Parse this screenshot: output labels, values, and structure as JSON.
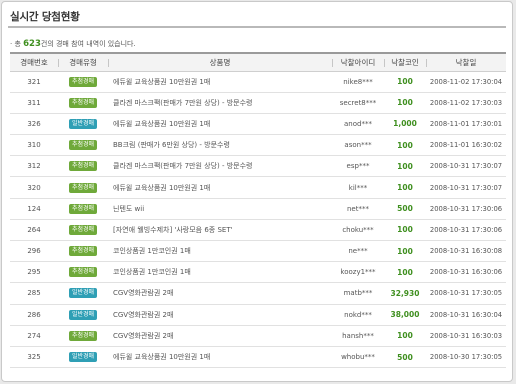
{
  "header": {
    "title": "실시간 당첨현황"
  },
  "summary": {
    "prefix": "· 총",
    "count": "623",
    "suffix": "건의 경매 참여 내역이 있습니다."
  },
  "columns": [
    "경매번호",
    "경매유형",
    "상품명",
    "낙찰아이디",
    "낙찰코인",
    "낙찰일"
  ],
  "badge_colors": {
    "추첨경매": "#6fa93a",
    "일반경매": "#2f9fb5"
  },
  "rows": [
    {
      "no": "321",
      "type": "추첨경매",
      "kind": "g",
      "product": "에듀윌 교육상품권 10만원권 1매",
      "winner": "nike8***",
      "coin": "100",
      "date": "2008-11-02 17:30:04"
    },
    {
      "no": "311",
      "type": "추첨경매",
      "kind": "g",
      "product": "클라겐 마스크팩(판매가 7만원 상당) - 방문수령",
      "winner": "secret8***",
      "coin": "100",
      "date": "2008-11-02 17:30:03"
    },
    {
      "no": "326",
      "type": "일반경매",
      "kind": "t",
      "product": "에듀윌 교육상품권 10만원권 1매",
      "winner": "anod***",
      "coin": "1,000",
      "date": "2008-11-01 17:30:01"
    },
    {
      "no": "310",
      "type": "추첨경매",
      "kind": "g",
      "product": "BB크림 (판매가 6만원 상당) - 방문수령",
      "winner": "ason***",
      "coin": "100",
      "date": "2008-11-01 16:30:02"
    },
    {
      "no": "312",
      "type": "추첨경매",
      "kind": "g",
      "product": "클라겐 마스크팩(판매가 7만원 상당) - 방문수령",
      "winner": "esp***",
      "coin": "100",
      "date": "2008-10-31 17:30:07"
    },
    {
      "no": "320",
      "type": "추첨경매",
      "kind": "g",
      "product": "에듀윌 교육상품권 10만원권 1매",
      "winner": "kil***",
      "coin": "100",
      "date": "2008-10-31 17:30:07"
    },
    {
      "no": "124",
      "type": "추첨경매",
      "kind": "g",
      "product": "닌텐도 wii",
      "winner": "net***",
      "coin": "500",
      "date": "2008-10-31 17:30:06"
    },
    {
      "no": "264",
      "type": "추첨경매",
      "kind": "g",
      "product": "[자연애 웰빙수제차] '사랑모음 6종 SET'",
      "winner": "choku***",
      "coin": "100",
      "date": "2008-10-31 17:30:06"
    },
    {
      "no": "296",
      "type": "추첨경매",
      "kind": "g",
      "product": "코인상품권 1만코인권 1매",
      "winner": "ne***",
      "coin": "100",
      "date": "2008-10-31 16:30:08"
    },
    {
      "no": "295",
      "type": "추첨경매",
      "kind": "g",
      "product": "코인상품권 1만코인권 1매",
      "winner": "koozy1***",
      "coin": "100",
      "date": "2008-10-31 16:30:06"
    },
    {
      "no": "285",
      "type": "일반경매",
      "kind": "t",
      "product": "CGV영화관람권 2매",
      "winner": "matb***",
      "coin": "32,930",
      "date": "2008-10-31 17:30:05"
    },
    {
      "no": "286",
      "type": "일반경매",
      "kind": "t",
      "product": "CGV영화관람권 2매",
      "winner": "nokd***",
      "coin": "38,000",
      "date": "2008-10-31 16:30:04"
    },
    {
      "no": "274",
      "type": "추첨경매",
      "kind": "g",
      "product": "CGV영화관람권 2매",
      "winner": "hansh***",
      "coin": "100",
      "date": "2008-10-31 16:30:03"
    },
    {
      "no": "325",
      "type": "일반경매",
      "kind": "t",
      "product": "에듀윌 교육상품권 10만원권 1매",
      "winner": "whobu***",
      "coin": "500",
      "date": "2008-10-30 17:30:05"
    }
  ]
}
